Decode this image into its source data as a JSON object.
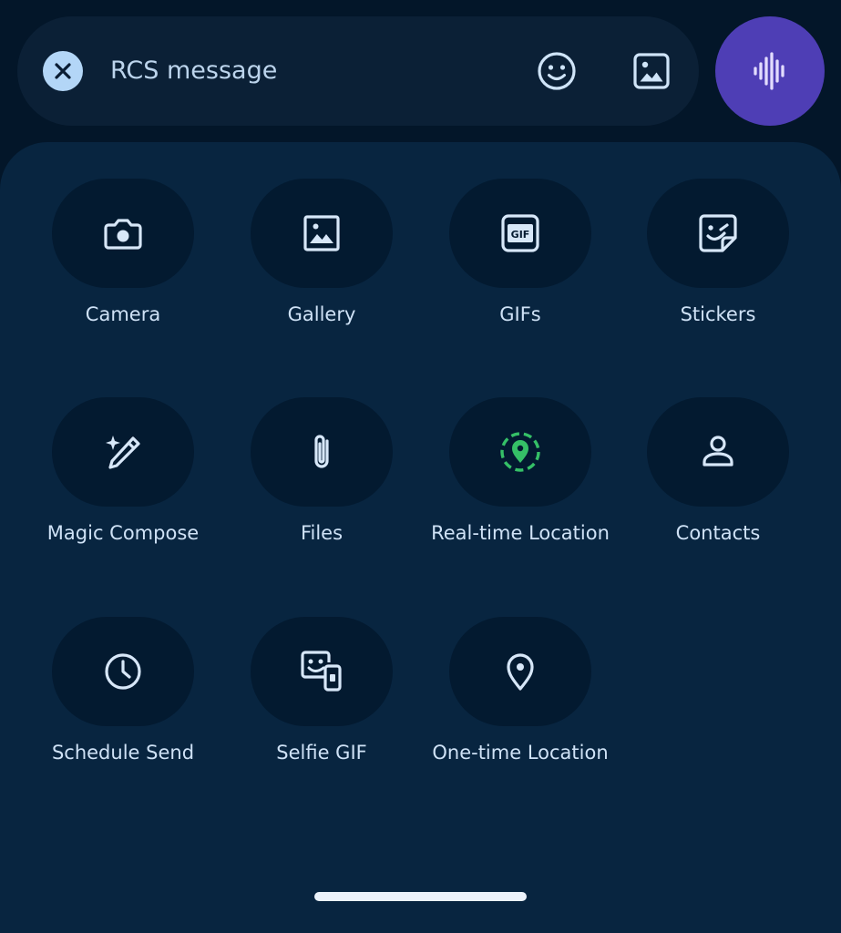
{
  "compose": {
    "placeholder": "RCS message",
    "close_icon": "close-icon",
    "emoji_icon": "emoji-icon",
    "image_icon": "image-icon",
    "voice_icon": "voice-wave-icon"
  },
  "attachments": [
    {
      "label": "Camera",
      "icon": "camera-icon"
    },
    {
      "label": "Gallery",
      "icon": "gallery-icon"
    },
    {
      "label": "GIFs",
      "icon": "gif-icon"
    },
    {
      "label": "Stickers",
      "icon": "sticker-icon"
    },
    {
      "label": "Magic Compose",
      "icon": "magic-pen-icon"
    },
    {
      "label": "Files",
      "icon": "paperclip-icon"
    },
    {
      "label": "Real-time Location",
      "icon": "live-location-icon"
    },
    {
      "label": "Contacts",
      "icon": "contact-icon"
    },
    {
      "label": "Schedule Send",
      "icon": "clock-icon"
    },
    {
      "label": "Selfie GIF",
      "icon": "selfie-gif-icon"
    },
    {
      "label": "One-time Location",
      "icon": "location-pin-icon"
    }
  ],
  "colors": {
    "background": "#031629",
    "panel": "#082540",
    "tile": "#031a30",
    "icon": "#d7e7f8",
    "accent_voice": "#4e3eb5",
    "accent_location": "#35c067",
    "close_bg": "#b3d6f7"
  }
}
